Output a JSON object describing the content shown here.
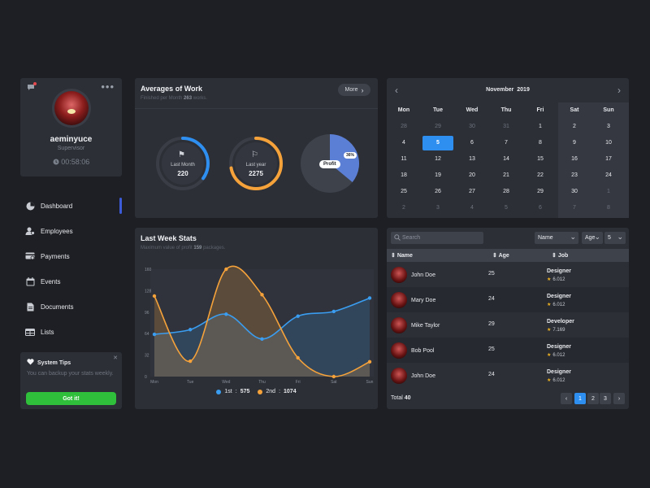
{
  "profile": {
    "name": "aeminyuce",
    "role": "Supervisor",
    "time": "00:58:06"
  },
  "nav": [
    {
      "label": "Dashboard"
    },
    {
      "label": "Employees"
    },
    {
      "label": "Payments"
    },
    {
      "label": "Events"
    },
    {
      "label": "Documents"
    },
    {
      "label": "Lists"
    }
  ],
  "tips": {
    "title": "System Tips",
    "text": "You can backup your stats weekly.",
    "button": "Got it!"
  },
  "averages": {
    "title": "Averages of Work",
    "subtitle_pre": "Finished per Month",
    "subtitle_num": "263",
    "subtitle_post": "works.",
    "more_label": "More",
    "rings": [
      {
        "label": "Last Month",
        "value": "220",
        "color": "#2f8ff0",
        "progress": 0.35
      },
      {
        "label": "Last year",
        "value": "2275",
        "color": "#f5a23a",
        "progress": 0.72
      }
    ],
    "pie": {
      "label": "Profit",
      "percent_label": "36%",
      "percent": 36
    }
  },
  "stats": {
    "title": "Last Week Stats",
    "subtitle_pre": "Maximum value of profit",
    "subtitle_num": "159",
    "subtitle_post": "packages.",
    "legend": [
      {
        "name": "1st",
        "value": "575",
        "color": "#3a9df0"
      },
      {
        "name": "2nd",
        "value": "1074",
        "color": "#f5a23a"
      }
    ]
  },
  "chart_data": {
    "type": "line",
    "x": [
      "Mon",
      "Tue",
      "Wed",
      "Thu",
      "Fri",
      "Sat",
      "Sun"
    ],
    "yticks": [
      0,
      32,
      64,
      96,
      128,
      160
    ],
    "ylim": [
      0,
      160
    ],
    "series": [
      {
        "name": "1st",
        "values": [
          63,
          70,
          93,
          56,
          90,
          97,
          117
        ],
        "color": "#3a9df0"
      },
      {
        "name": "2nd",
        "values": [
          120,
          23,
          160,
          122,
          28,
          0,
          22
        ],
        "color": "#f5a23a"
      }
    ],
    "legend": "bottom",
    "grid": false
  },
  "calendar": {
    "month": "November",
    "year": "2019",
    "weekdays": [
      "Mon",
      "Tue",
      "Wed",
      "Thu",
      "Fri",
      "Sat",
      "Sun"
    ],
    "weeks": [
      [
        {
          "d": "28",
          "o": true
        },
        {
          "d": "29",
          "o": true
        },
        {
          "d": "30",
          "o": true
        },
        {
          "d": "31",
          "o": true
        },
        {
          "d": "1"
        },
        {
          "d": "2"
        },
        {
          "d": "3"
        }
      ],
      [
        {
          "d": "4"
        },
        {
          "d": "5",
          "today": true
        },
        {
          "d": "6"
        },
        {
          "d": "7"
        },
        {
          "d": "8"
        },
        {
          "d": "9"
        },
        {
          "d": "10"
        }
      ],
      [
        {
          "d": "11"
        },
        {
          "d": "12"
        },
        {
          "d": "13"
        },
        {
          "d": "14"
        },
        {
          "d": "15"
        },
        {
          "d": "16"
        },
        {
          "d": "17"
        }
      ],
      [
        {
          "d": "18"
        },
        {
          "d": "19"
        },
        {
          "d": "20"
        },
        {
          "d": "21"
        },
        {
          "d": "22"
        },
        {
          "d": "23"
        },
        {
          "d": "24"
        }
      ],
      [
        {
          "d": "25"
        },
        {
          "d": "26"
        },
        {
          "d": "27"
        },
        {
          "d": "28"
        },
        {
          "d": "29"
        },
        {
          "d": "30"
        },
        {
          "d": "1",
          "o": true
        }
      ],
      [
        {
          "d": "2",
          "o": true
        },
        {
          "d": "3",
          "o": true
        },
        {
          "d": "4",
          "o": true
        },
        {
          "d": "5",
          "o": true
        },
        {
          "d": "6",
          "o": true
        },
        {
          "d": "7",
          "o": true
        },
        {
          "d": "8",
          "o": true
        }
      ]
    ]
  },
  "table": {
    "search_placeholder": "Search",
    "filters": [
      {
        "value": "Name"
      },
      {
        "value": "Age"
      },
      {
        "value": "5"
      }
    ],
    "columns": [
      "Name",
      "Age",
      "Job"
    ],
    "rows": [
      {
        "name": "John Doe",
        "age": "25",
        "job": "Designer",
        "rating": "6.012"
      },
      {
        "name": "Mary Doe",
        "age": "24",
        "job": "Designer",
        "rating": "6.012"
      },
      {
        "name": "Mike Taylor",
        "age": "29",
        "job": "Developer",
        "rating": "7.169"
      },
      {
        "name": "Bob Pool",
        "age": "25",
        "job": "Designer",
        "rating": "6.012"
      },
      {
        "name": "John Doe",
        "age": "24",
        "job": "Designer",
        "rating": "6.012"
      }
    ],
    "total_label": "Total",
    "total_value": "40",
    "pages": [
      "1",
      "2",
      "3"
    ],
    "active_page": "1"
  }
}
